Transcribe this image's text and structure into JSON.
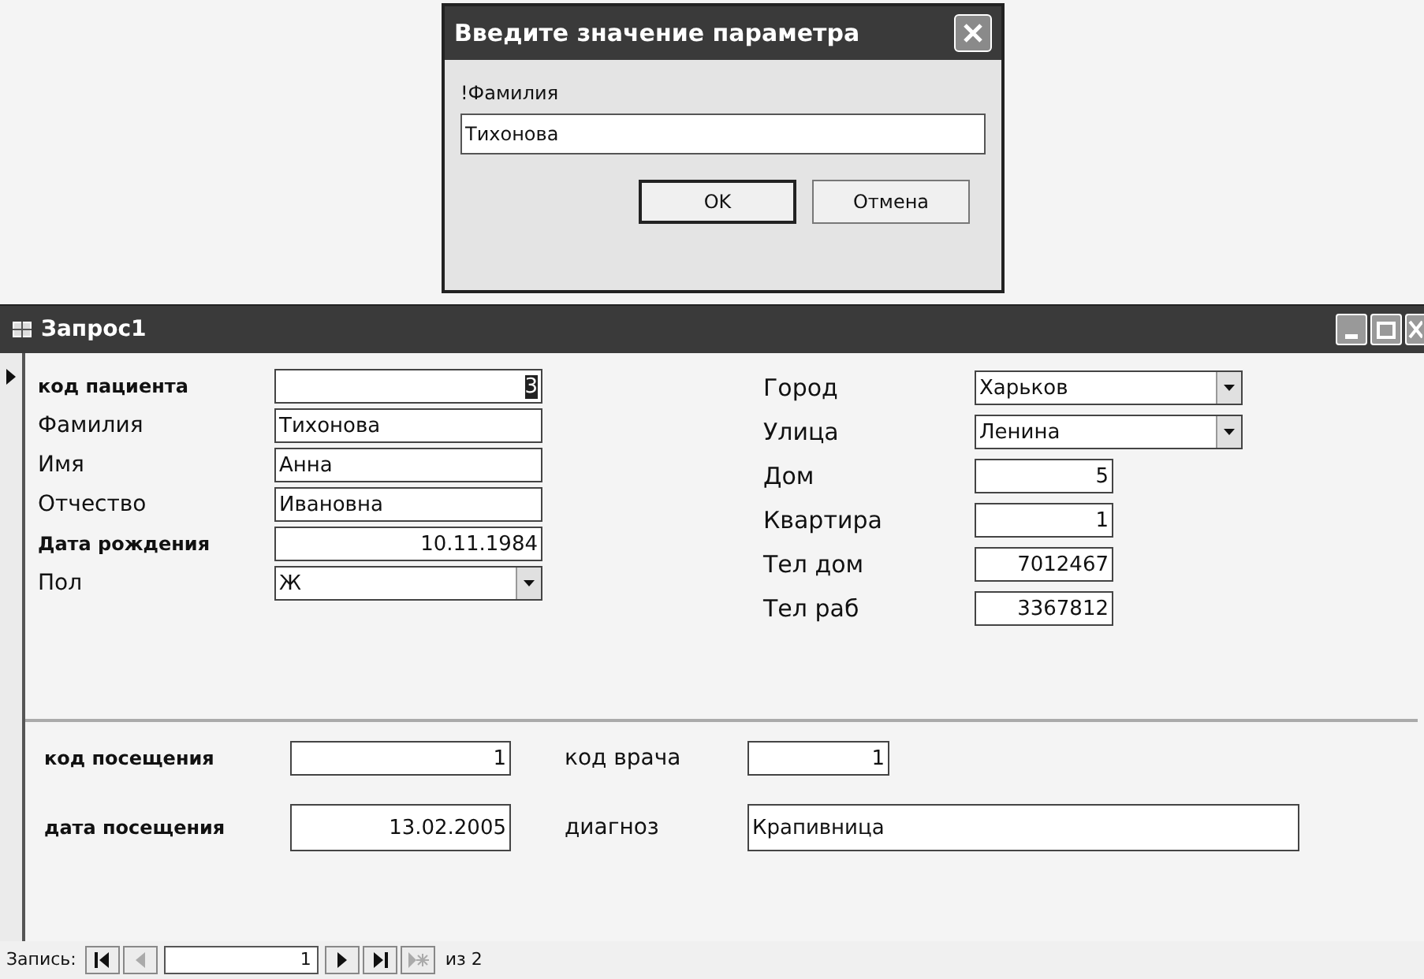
{
  "dialog": {
    "title": "Введите значение параметра",
    "prompt": "!Фамилия",
    "value": "Тихонова",
    "buttons": [
      {
        "label": "OK",
        "default": true
      },
      {
        "label": "Отмена",
        "default": false
      }
    ]
  },
  "window": {
    "title": "Запрос1"
  },
  "left_fields": [
    {
      "label": "код пациента",
      "value": "3",
      "kind": "number",
      "bold": true,
      "selected": true
    },
    {
      "label": "Фамилия",
      "value": "Тихонова",
      "kind": "text",
      "bold": false,
      "selected": false
    },
    {
      "label": "Имя",
      "value": "Анна",
      "kind": "text",
      "bold": false,
      "selected": false
    },
    {
      "label": "Отчество",
      "value": "Ивановна",
      "kind": "text",
      "bold": false,
      "selected": false
    },
    {
      "label": "Дата рождения",
      "value": "10.11.1984",
      "kind": "date",
      "bold": true,
      "selected": false
    },
    {
      "label": "Пол",
      "value": "Ж",
      "kind": "combo",
      "bold": false,
      "selected": false
    }
  ],
  "right_fields": [
    {
      "label": "Город",
      "value": "Харьков",
      "kind": "combo"
    },
    {
      "label": "Улица",
      "value": "Ленина",
      "kind": "combo"
    },
    {
      "label": "Дом",
      "value": "5",
      "kind": "number"
    },
    {
      "label": "Квартира",
      "value": "1",
      "kind": "number"
    },
    {
      "label": "Тел дом",
      "value": "7012467",
      "kind": "number"
    },
    {
      "label": "Тел раб",
      "value": "3367812",
      "kind": "number"
    }
  ],
  "visit": [
    {
      "label": "код посещения",
      "value": "1"
    },
    {
      "label": "код врача",
      "value": "1"
    },
    {
      "label": "дата посещения",
      "value": "13.02.2005"
    },
    {
      "label": "диагноз",
      "value": "Крапивница"
    }
  ],
  "navigator": {
    "label": "Запись:",
    "record": "1",
    "total": "из 2",
    "buttons": [
      {
        "kind": "first",
        "disabled": false
      },
      {
        "kind": "prev",
        "disabled": true
      },
      {
        "kind": "next",
        "disabled": false
      },
      {
        "kind": "last",
        "disabled": false
      },
      {
        "kind": "new",
        "disabled": true
      }
    ]
  }
}
